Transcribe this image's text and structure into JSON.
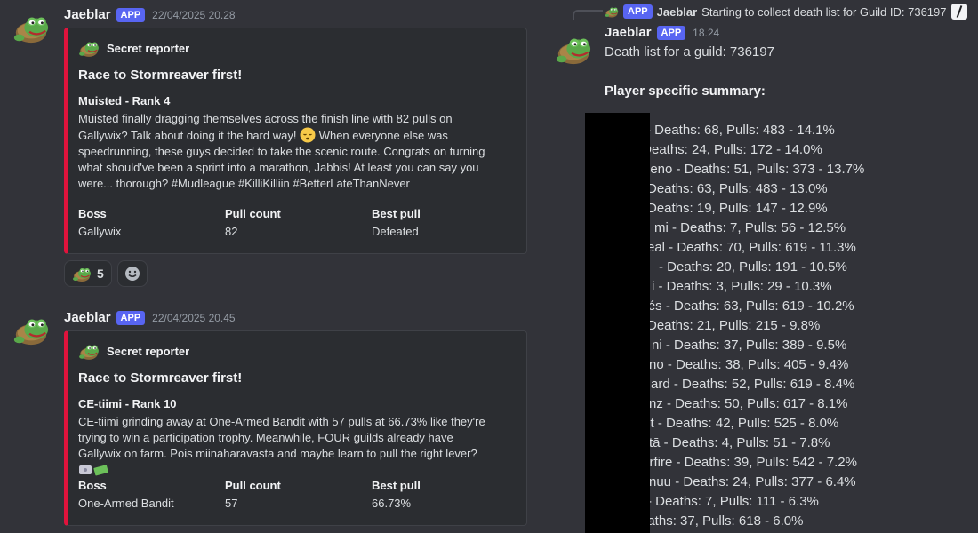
{
  "messages": [
    {
      "username": "Jaeblar",
      "badge": "APP",
      "timestamp": "22/04/2025 20.28",
      "embed": {
        "author": "Secret reporter",
        "title": "Race to Stormreaver first!",
        "subtitle": "Muisted - Rank 4",
        "desc_parts": [
          "Muisted finally dragging themselves across the finish line with 82 pulls on Gallywix? Talk about doing it the hard way! ",
          " When everyone else was speedrunning, these guys decided to take the scenic route. Congrats on turning what should've been a sprint into a marathon, Jabbis! At least you can say you were... thorough? #Mudleague #KilliKilliin #BetterLateThanNever"
        ],
        "fields": [
          {
            "name": "Boss",
            "value": "Gallywix"
          },
          {
            "name": "Pull count",
            "value": "82"
          },
          {
            "name": "Best pull",
            "value": "Defeated"
          }
        ]
      },
      "reactions": [
        {
          "emoji": "pepe-icon",
          "count": "5"
        }
      ]
    },
    {
      "username": "Jaeblar",
      "badge": "APP",
      "timestamp": "22/04/2025 20.45",
      "embed": {
        "author": "Secret reporter",
        "title": "Race to Stormreaver first!",
        "subtitle": "CE-tiimi - Rank 10",
        "desc_parts": [
          "CE-tiimi grinding away at One-Armed Bandit with 57 pulls at 66.73% like they're trying to win a participation trophy. Meanwhile, FOUR guilds already have Gallywix on farm. Pois miinaharavasta and maybe learn to pull the right lever? "
        ],
        "fields": [
          {
            "name": "Boss",
            "value": "One-Armed Bandit"
          },
          {
            "name": "Pull count",
            "value": "57"
          },
          {
            "name": "Best pull",
            "value": "66.73%"
          }
        ]
      }
    }
  ],
  "right": {
    "reply": {
      "badge": "APP",
      "username": "Jaeblar",
      "text": "Starting to collect death list for Guild ID: 736197"
    },
    "username": "Jaeblar",
    "badge": "APP",
    "timestamp": "18.24",
    "line1": "Death list for a guild: 736197",
    "heading": "Player specific summary:",
    "rows": [
      " - Deaths: 68, Pulls: 483 - 14.1%",
      "mi - Deaths: 24, Pulls: 172 - 14.0%",
      "ieno - Deaths: 51, Pulls: 373 - 13.7%",
      "Deaths: 63, Pulls: 483 - 13.0%",
      "Deaths: 19, Pulls: 147 - 12.9%",
      "mi - Deaths: 7, Pulls: 56 - 12.5%",
      "eal - Deaths: 70, Pulls: 619 - 11.3%",
      " - Deaths: 20, Pulls: 191 - 10.5%",
      "i - Deaths: 3, Pulls: 29 - 10.3%",
      "klés - Deaths: 63, Pulls: 619 - 10.2%",
      "Deaths: 21, Pulls: 215 - 9.8%",
      "ni - Deaths: 37, Pulls: 389 - 9.5%",
      "no - Deaths: 38, Pulls: 405 - 9.4%",
      "ard - Deaths: 52, Pulls: 619 - 8.4%",
      "nz - Deaths: 50, Pulls: 617 - 8.1%",
      "st - Deaths: 42, Pulls: 525 - 8.0%",
      "tā - Deaths: 4, Pulls: 51 - 7.8%",
      "terfire - Deaths: 39, Pulls: 542 - 7.2%",
      "nuu - Deaths: 24, Pulls: 377 - 6.4%",
      " - Deaths: 7, Pulls: 111 - 6.3%",
      "eaths: 37, Pulls: 618 - 6.0%"
    ]
  },
  "colors": {
    "background": "#323339",
    "embed_bg": "#2b2d31",
    "embed_accent": "#e0133c",
    "app_badge": "#5865f2"
  }
}
